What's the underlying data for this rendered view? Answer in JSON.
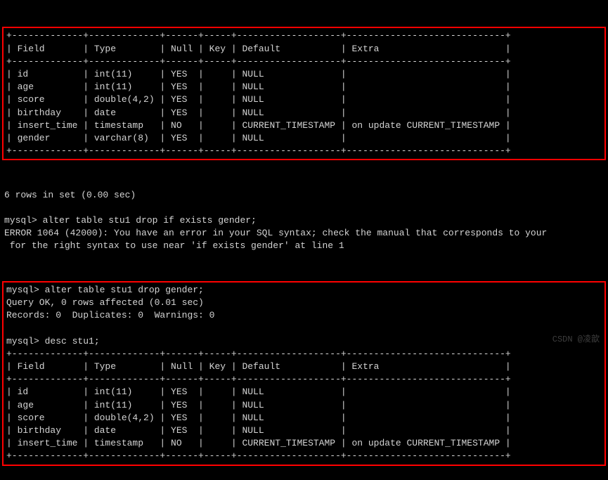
{
  "table1": {
    "border": "+-------------+-------------+------+-----+-------------------+-----------------------------+",
    "header": "| Field       | Type        | Null | Key | Default           | Extra                       |",
    "rows": [
      "| id          | int(11)     | YES  |     | NULL              |                             |",
      "| age         | int(11)     | YES  |     | NULL              |                             |",
      "| score       | double(4,2) | YES  |     | NULL              |                             |",
      "| birthday    | date        | YES  |     | NULL              |                             |",
      "| insert_time | timestamp   | NO   |     | CURRENT_TIMESTAMP | on update CURRENT_TIMESTAMP |",
      "| gender      | varchar(8)  | YES  |     | NULL              |                             |"
    ]
  },
  "gap": {
    "rows_msg": "6 rows in set (0.00 sec)",
    "blank": "",
    "cmd1": "mysql> alter table stu1 drop if exists gender;",
    "err1": "ERROR 1064 (42000): You have an error in your SQL syntax; check the manual that corresponds to your",
    "err2": " for the right syntax to use near 'if exists gender' at line 1"
  },
  "box2": {
    "cmd2": "mysql> alter table stu1 drop gender;",
    "ok": "Query OK, 0 rows affected (0.01 sec)",
    "records": "Records: 0  Duplicates: 0  Warnings: 0",
    "blank": "",
    "cmd3": "mysql> desc stu1;"
  },
  "table2": {
    "border": "+-------------+-------------+------+-----+-------------------+-----------------------------+",
    "header": "| Field       | Type        | Null | Key | Default           | Extra                       |",
    "rows": [
      "| id          | int(11)     | YES  |     | NULL              |                             |",
      "| age         | int(11)     | YES  |     | NULL              |                             |",
      "| score       | double(4,2) | YES  |     | NULL              |                             |",
      "| birthday    | date        | YES  |     | NULL              |                             |",
      "| insert_time | timestamp   | NO   |     | CURRENT_TIMESTAMP | on update CURRENT_TIMESTAMP |"
    ]
  },
  "watermark": "CSDN @凌歆",
  "chart_data": {
    "type": "table",
    "tables": [
      {
        "title": "desc stu1 (before drop)",
        "columns": [
          "Field",
          "Type",
          "Null",
          "Key",
          "Default",
          "Extra"
        ],
        "rows": [
          [
            "id",
            "int(11)",
            "YES",
            "",
            "NULL",
            ""
          ],
          [
            "age",
            "int(11)",
            "YES",
            "",
            "NULL",
            ""
          ],
          [
            "score",
            "double(4,2)",
            "YES",
            "",
            "NULL",
            ""
          ],
          [
            "birthday",
            "date",
            "YES",
            "",
            "NULL",
            ""
          ],
          [
            "insert_time",
            "timestamp",
            "NO",
            "",
            "CURRENT_TIMESTAMP",
            "on update CURRENT_TIMESTAMP"
          ],
          [
            "gender",
            "varchar(8)",
            "YES",
            "",
            "NULL",
            ""
          ]
        ]
      },
      {
        "title": "desc stu1 (after drop gender)",
        "columns": [
          "Field",
          "Type",
          "Null",
          "Key",
          "Default",
          "Extra"
        ],
        "rows": [
          [
            "id",
            "int(11)",
            "YES",
            "",
            "NULL",
            ""
          ],
          [
            "age",
            "int(11)",
            "YES",
            "",
            "NULL",
            ""
          ],
          [
            "score",
            "double(4,2)",
            "YES",
            "",
            "NULL",
            ""
          ],
          [
            "birthday",
            "date",
            "YES",
            "",
            "NULL",
            ""
          ],
          [
            "insert_time",
            "timestamp",
            "NO",
            "",
            "CURRENT_TIMESTAMP",
            "on update CURRENT_TIMESTAMP"
          ]
        ]
      }
    ]
  }
}
